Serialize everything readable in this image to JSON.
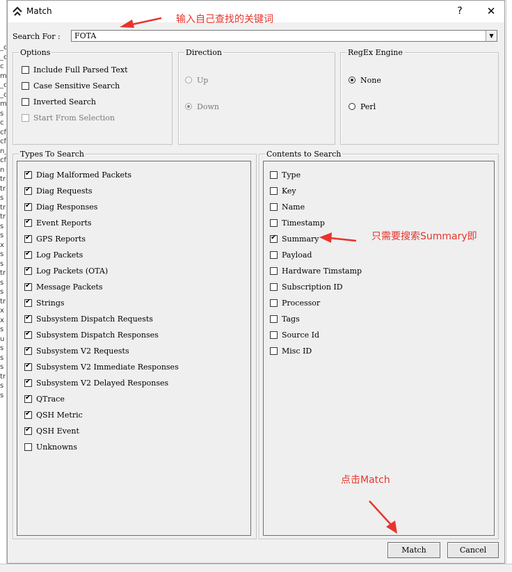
{
  "window": {
    "title": "Match",
    "help": "?",
    "close": "✕"
  },
  "search": {
    "label": "Search For :",
    "value": "FOTA"
  },
  "options": {
    "title": "Options",
    "items": [
      {
        "label": "Include Full Parsed Text",
        "checked": false,
        "enabled": true
      },
      {
        "label": "Case  Sensitive Search",
        "checked": false,
        "enabled": true
      },
      {
        "label": "Inverted Search",
        "checked": false,
        "enabled": true
      },
      {
        "label": "Start From Selection",
        "checked": false,
        "enabled": false
      }
    ]
  },
  "direction": {
    "title": "Direction",
    "items": [
      {
        "label": "Up",
        "selected": false,
        "enabled": false
      },
      {
        "label": "Down",
        "selected": true,
        "enabled": false
      }
    ]
  },
  "regex": {
    "title": "RegEx Engine",
    "items": [
      {
        "label": "None",
        "selected": true,
        "enabled": true
      },
      {
        "label": "Perl",
        "selected": false,
        "enabled": true
      }
    ]
  },
  "types": {
    "title": "Types To Search",
    "items": [
      {
        "label": "Diag Malformed Packets",
        "checked": true
      },
      {
        "label": "Diag Requests",
        "checked": true
      },
      {
        "label": "Diag Responses",
        "checked": true
      },
      {
        "label": "Event Reports",
        "checked": true
      },
      {
        "label": "GPS Reports",
        "checked": true
      },
      {
        "label": "Log Packets",
        "checked": true
      },
      {
        "label": "Log Packets (OTA)",
        "checked": true
      },
      {
        "label": "Message Packets",
        "checked": true
      },
      {
        "label": "Strings",
        "checked": true
      },
      {
        "label": "Subsystem Dispatch Requests",
        "checked": true
      },
      {
        "label": "Subsystem Dispatch Responses",
        "checked": true
      },
      {
        "label": "Subsystem V2 Requests",
        "checked": true
      },
      {
        "label": "Subsystem V2 Immediate Responses",
        "checked": true
      },
      {
        "label": "Subsystem V2 Delayed Responses",
        "checked": true
      },
      {
        "label": "QTrace",
        "checked": true
      },
      {
        "label": "QSH Metric",
        "checked": true
      },
      {
        "label": "QSH Event",
        "checked": true
      },
      {
        "label": "Unknowns",
        "checked": false
      }
    ]
  },
  "contents": {
    "title": "Contents to Search",
    "items": [
      {
        "label": "Type",
        "checked": false
      },
      {
        "label": "Key",
        "checked": false
      },
      {
        "label": "Name",
        "checked": false
      },
      {
        "label": "Timestamp",
        "checked": false
      },
      {
        "label": "Summary",
        "checked": true
      },
      {
        "label": "Payload",
        "checked": false
      },
      {
        "label": "Hardware Timstamp",
        "checked": false
      },
      {
        "label": "Subscription ID",
        "checked": false
      },
      {
        "label": "Processor",
        "checked": false
      },
      {
        "label": "Tags",
        "checked": false
      },
      {
        "label": "Source Id",
        "checked": false
      },
      {
        "label": "Misc ID",
        "checked": false
      }
    ]
  },
  "buttons": {
    "match": "Match",
    "cancel": "Cancel"
  },
  "annotations": {
    "keyword": "输入自己查找的关键词",
    "summary": "只需要搜索Summary即",
    "match": "点击Match",
    "color": "#e8342d"
  },
  "background": {
    "left_fragments": [
      "_c",
      "_c",
      "c",
      "m",
      "_c",
      "_c",
      "m",
      "s",
      "c",
      "cf",
      "cf",
      "n_",
      "cf",
      "n",
      "tr",
      "tr",
      "s",
      "tr",
      "tr",
      "s",
      "s",
      "x",
      "s",
      "s",
      "tr",
      "s",
      "s",
      "tr",
      "x",
      "x",
      "s",
      "u",
      "s",
      "s",
      "s",
      "tr",
      "s",
      "s"
    ]
  }
}
